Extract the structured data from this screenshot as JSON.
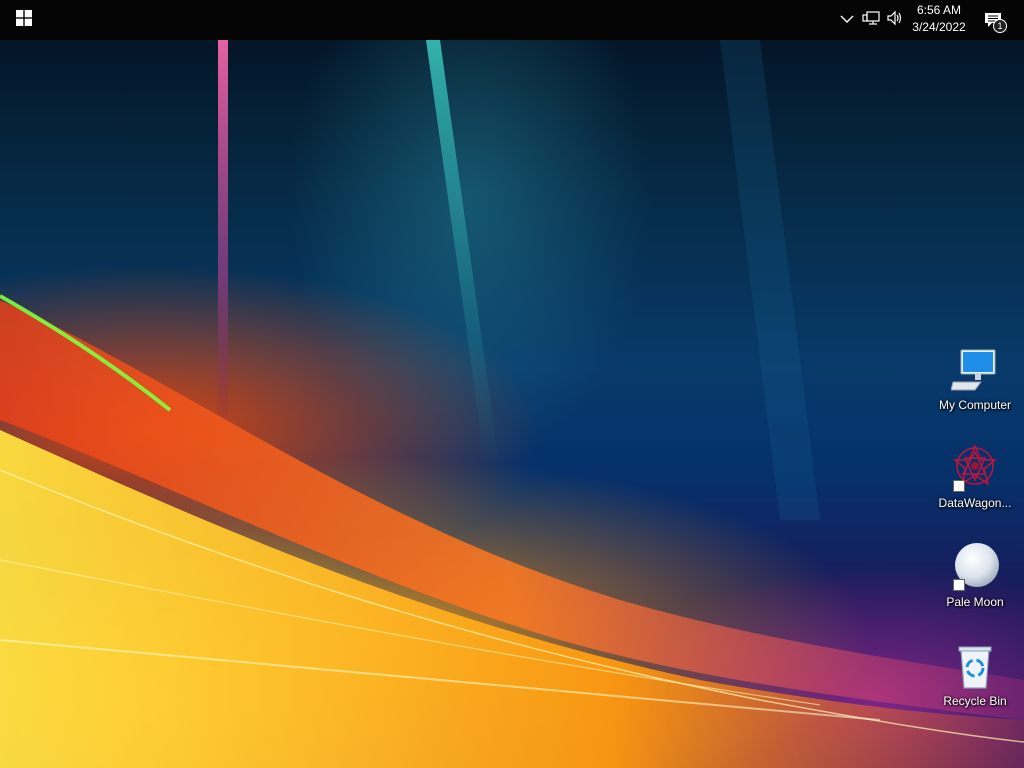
{
  "taskbar": {
    "start_icon": "windows-start-icon",
    "tray_icons": [
      "chevron-up-icon",
      "network-icon",
      "volume-icon"
    ],
    "clock": {
      "time": "6:56 AM",
      "date": "3/24/2022"
    },
    "notifications": {
      "icon": "action-center-icon",
      "badge": "1"
    }
  },
  "desktop": {
    "icons": [
      {
        "label": "My Computer",
        "icon": "computer-icon"
      },
      {
        "label": "DataWagon...",
        "icon": "datawagon-icon"
      },
      {
        "label": "Pale Moon",
        "icon": "pale-moon-icon"
      },
      {
        "label": "Recycle Bin",
        "icon": "recycle-bin-icon"
      }
    ]
  },
  "colors": {
    "taskbar": "#050505",
    "sky_top": "#03101f",
    "sky_mid": "#083a6a",
    "orange_wave": "#ff9a10",
    "yellow_wave": "#ffd828",
    "red_wave": "#d8401a",
    "purple_corner": "#2a145a"
  }
}
